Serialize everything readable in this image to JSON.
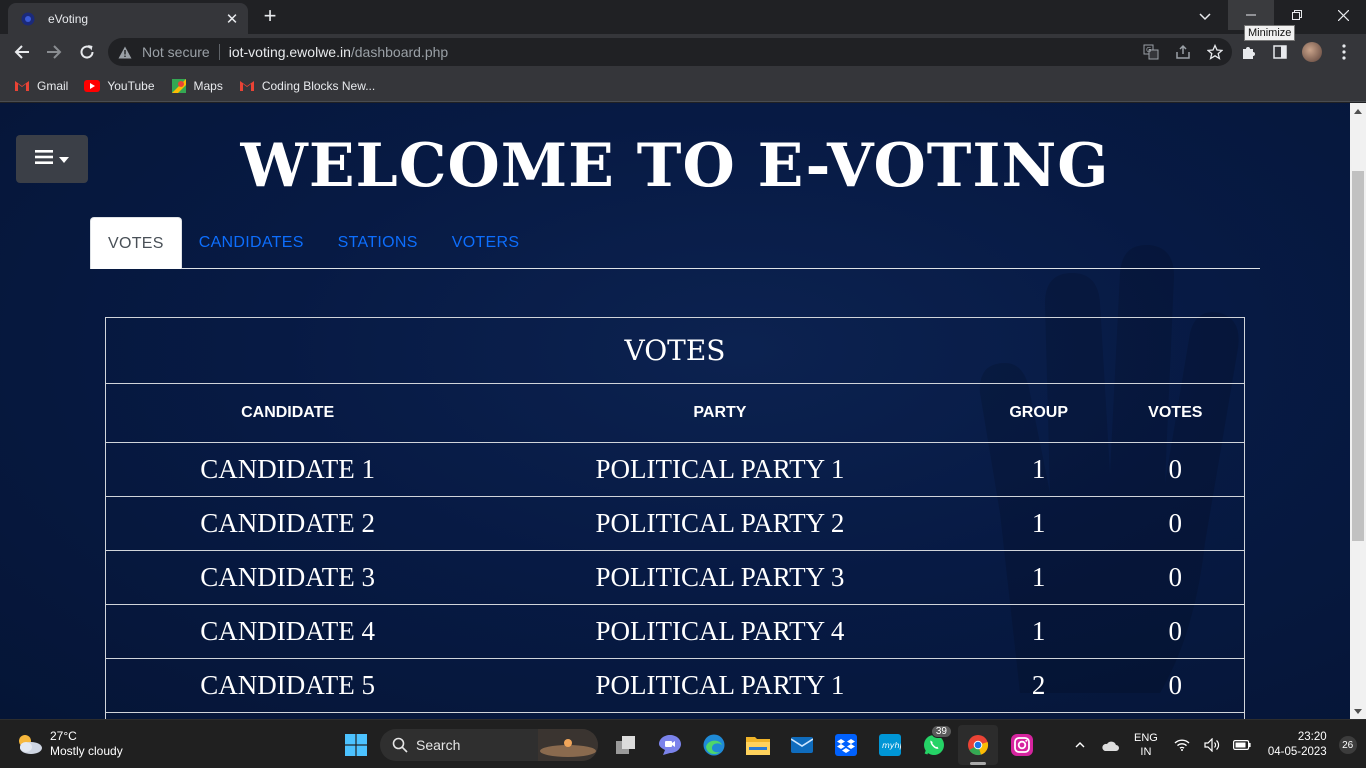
{
  "browser": {
    "tab_title": "eVoting",
    "tooltip": "Minimize",
    "omnibox": {
      "security_label": "Not secure",
      "host": "iot-voting.ewolwe.in",
      "path": "/dashboard.php"
    },
    "bookmarks": [
      {
        "label": "Gmail",
        "icon": "gmail-icon"
      },
      {
        "label": "YouTube",
        "icon": "youtube-icon"
      },
      {
        "label": "Maps",
        "icon": "maps-icon"
      },
      {
        "label": "Coding Blocks New...",
        "icon": "gmail-icon"
      }
    ]
  },
  "page": {
    "heading": "WELCOME TO E-VOTING",
    "tabs": [
      {
        "label": "VOTES",
        "active": true
      },
      {
        "label": "CANDIDATES",
        "active": false
      },
      {
        "label": "STATIONS",
        "active": false
      },
      {
        "label": "VOTERS",
        "active": false
      }
    ],
    "table": {
      "caption": "VOTES",
      "columns": [
        "CANDIDATE",
        "PARTY",
        "GROUP",
        "VOTES"
      ],
      "rows": [
        [
          "CANDIDATE 1",
          "POLITICAL PARTY 1",
          "1",
          "0"
        ],
        [
          "CANDIDATE 2",
          "POLITICAL PARTY 2",
          "1",
          "0"
        ],
        [
          "CANDIDATE 3",
          "POLITICAL PARTY 3",
          "1",
          "0"
        ],
        [
          "CANDIDATE 4",
          "POLITICAL PARTY 4",
          "1",
          "0"
        ],
        [
          "CANDIDATE 5",
          "POLITICAL PARTY 1",
          "2",
          "0"
        ]
      ]
    },
    "colors": {
      "background": "#071a44",
      "tab_link": "#0d6efd",
      "text": "#ffffff"
    }
  },
  "taskbar": {
    "weather": {
      "temp": "27°C",
      "condition": "Mostly cloudy"
    },
    "search_label": "Search",
    "whatsapp_badge": "39",
    "language": {
      "line1": "ENG",
      "line2": "IN"
    },
    "clock": {
      "time": "23:20",
      "date": "04-05-2023"
    },
    "notification_count": "26"
  }
}
